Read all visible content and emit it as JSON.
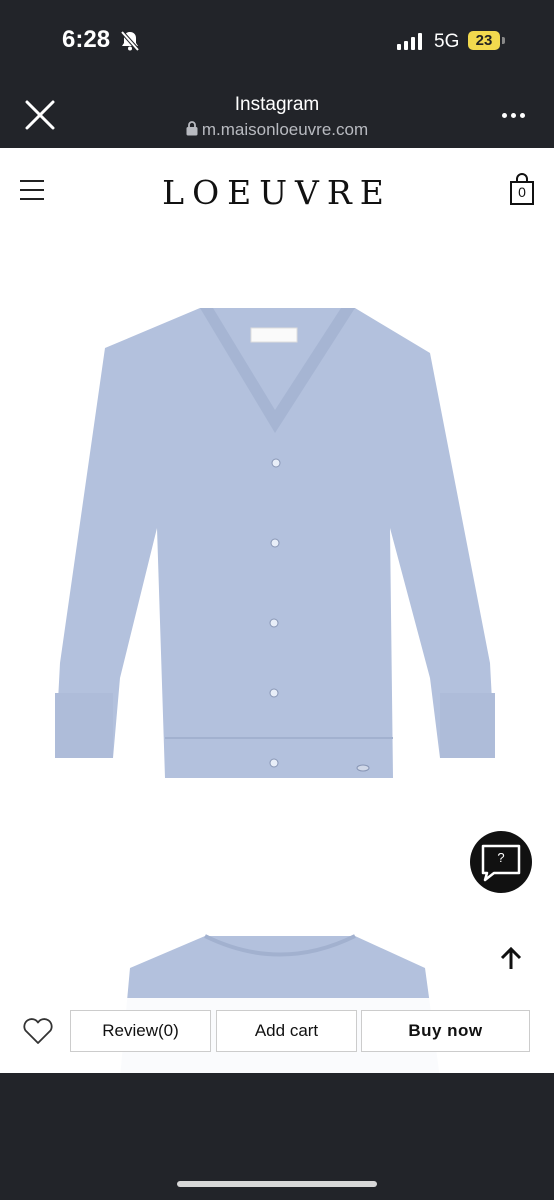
{
  "status_bar": {
    "time": "6:28",
    "network": "5G",
    "battery": "23"
  },
  "browser": {
    "title": "Instagram",
    "url": "m.maisonloeuvre.com"
  },
  "header": {
    "logo": "LOEUVRE",
    "cart_count": "0"
  },
  "product": {
    "color": "#b3c1dd"
  },
  "chat": {
    "label": "?"
  },
  "actions": {
    "review": "Review(0)",
    "add_cart": "Add cart",
    "buy_now": "Buy now"
  },
  "icons": [
    "bell-slash-icon",
    "signal-icon",
    "battery-icon",
    "close-icon",
    "lock-icon",
    "more-icon",
    "menu-icon",
    "shopping-bag-icon",
    "chat-icon",
    "arrow-up-icon",
    "heart-icon"
  ]
}
